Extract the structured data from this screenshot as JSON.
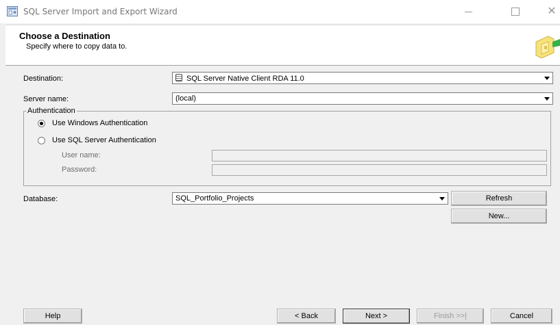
{
  "window": {
    "title": "SQL Server Import and Export Wizard",
    "close_glyph": "✕"
  },
  "header": {
    "title": "Choose a Destination",
    "subtitle": "Specify where to copy data to."
  },
  "destination": {
    "label": "Destination:",
    "value": "SQL Server Native Client RDA 11.0",
    "icon": "database-icon"
  },
  "server": {
    "label": "Server name:",
    "value": "(local)"
  },
  "authentication": {
    "legend": "Authentication",
    "windows_label": "Use Windows Authentication",
    "sql_label": "Use SQL Server Authentication",
    "selected": "windows",
    "username_label": "User name:",
    "username_value": "",
    "password_label": "Password:",
    "password_value": ""
  },
  "database": {
    "label": "Database:",
    "value": "SQL_Portfolio_Projects",
    "refresh_label": "Refresh",
    "new_label": "New..."
  },
  "footer": {
    "help_label": "Help",
    "back_label": "< Back",
    "next_label": "Next >",
    "finish_label": "Finish >>|",
    "cancel_label": "Cancel"
  },
  "colors": {
    "window_bg": "#f0f0f0",
    "header_bg": "#ffffff",
    "disabled_text": "#6d6d6d"
  }
}
